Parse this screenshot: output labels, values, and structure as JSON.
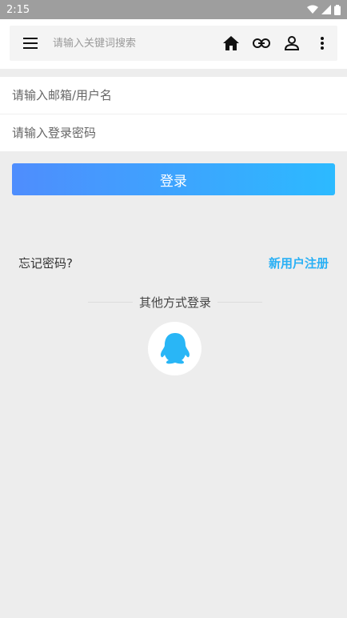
{
  "status_bar": {
    "time": "2:15"
  },
  "toolbar": {
    "search_placeholder": "请输入关键词搜索",
    "icons": [
      "menu-icon",
      "home-icon",
      "link-icon",
      "person-icon",
      "more-vert-icon"
    ]
  },
  "form": {
    "username_placeholder": "请输入邮箱/用户名",
    "password_placeholder": "请输入登录密码",
    "login_label": "登录"
  },
  "links": {
    "forgot_password": "忘记密码?",
    "register": "新用户注册"
  },
  "other_login": {
    "label": "其他方式登录",
    "qq_icon": "qq-penguin-icon"
  },
  "colors": {
    "accent": "#29b0f5",
    "button_gradient_start": "#4f8dfd",
    "button_gradient_end": "#2cbaff",
    "background": "#ededed"
  }
}
